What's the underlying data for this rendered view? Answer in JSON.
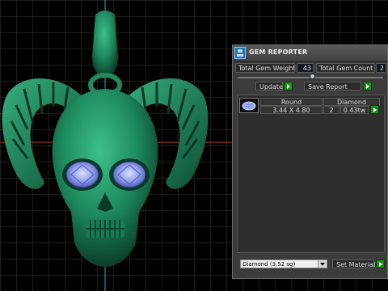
{
  "panel": {
    "title": "GEM REPORTER",
    "total_gem_weight_label": "Total Gem Weight",
    "total_gem_weight_value": "43",
    "total_gem_count_label": "Total Gem Count",
    "total_gem_count_value": "2",
    "update_label": "Update",
    "save_report_label": "Save Report",
    "gem_rows": [
      {
        "shape": "Round",
        "material": "Diamond",
        "size": "3.44 X 4.80",
        "count": "2",
        "weight": "0.43tw"
      }
    ],
    "material_select_value": "Diamond    (3.52 sg)",
    "set_material_label": "Set Material"
  },
  "viewport": {
    "background_color": "#000000",
    "grid_color": "#3a3a3a",
    "model_color": "#1f8a5c",
    "gem_color": "#8f9de8"
  }
}
